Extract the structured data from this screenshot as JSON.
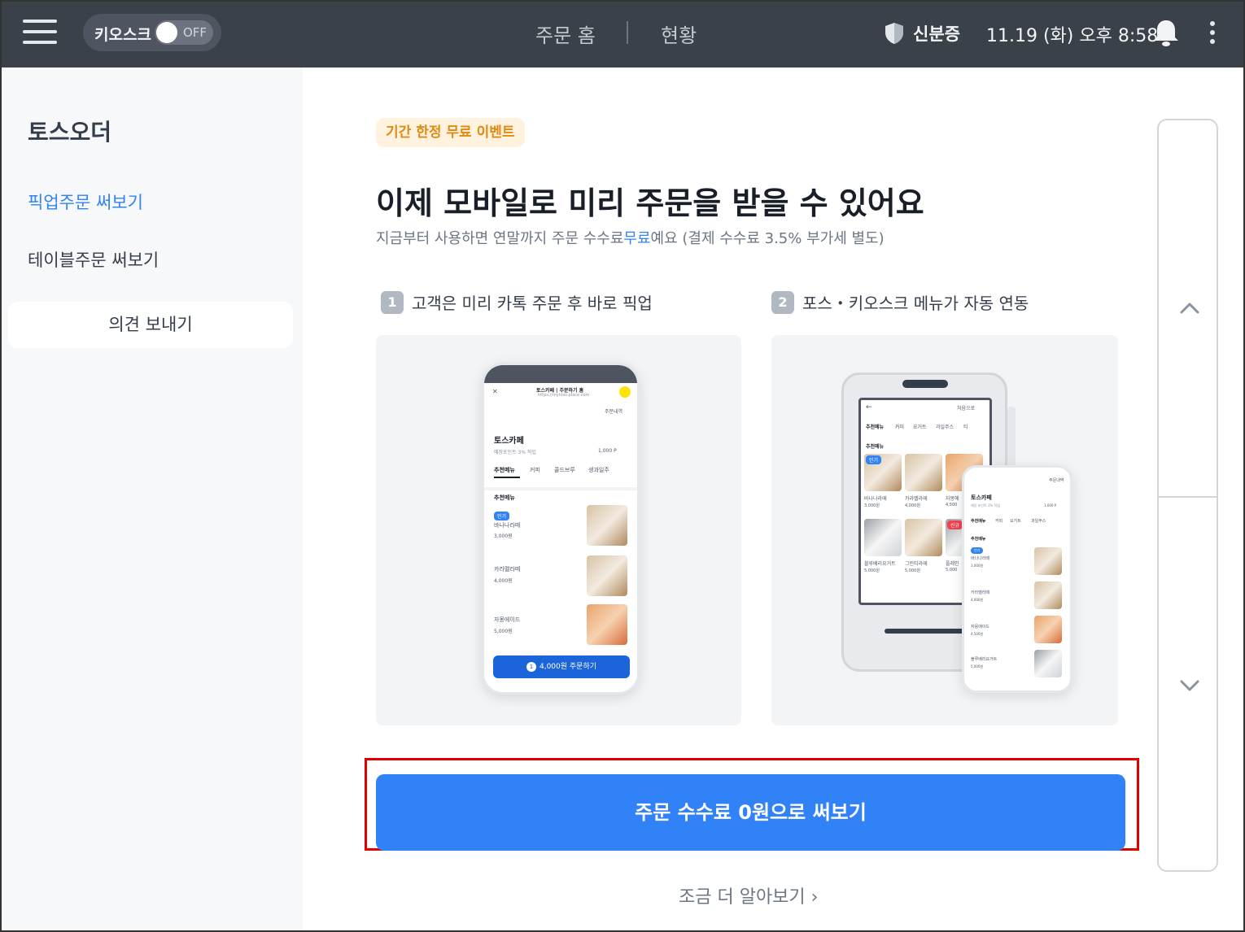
{
  "topbar": {
    "kiosk_label": "키오스크",
    "kiosk_toggle": "OFF",
    "nav_home": "주문 홈",
    "nav_status": "현황",
    "id_label": "신분증",
    "datetime": "11.19 (화) 오후 8:58"
  },
  "sidebar": {
    "title": "토스오더",
    "items": [
      {
        "label": "픽업주문 써보기"
      },
      {
        "label": "테이블주문 써보기"
      }
    ],
    "feedback": "의견 보내기"
  },
  "main": {
    "badge": "기간 한정 무료 이벤트",
    "headline": "이제 모바일로 미리 주문을 받을 수 있어요",
    "sub_pre": "지금부터 사용하면 연말까지 주문 수수료",
    "sub_hl": "무료",
    "sub_post": "예요 (결제 수수료 3.5% 부가세 별도)",
    "steps": [
      {
        "num": "1",
        "label": "고객은 미리 카톡 주문 후 바로 픽업"
      },
      {
        "num": "2",
        "label": "포스・키오스크 메뉴가 자동 연동"
      }
    ],
    "cta": "주문 수수료 0원으로 써보기",
    "more": "조금 더 알아보기 ›"
  },
  "phone1": {
    "url_title": "토스카페 | 주문하기 홈",
    "url": "https://mytoss.place.com",
    "history": "주문내역",
    "store": "토스카페",
    "points": "매장포인트 3% 적립",
    "points_val": "1,000 P",
    "tabs": [
      "추천메뉴",
      "커피",
      "콜드브루",
      "생과일주"
    ],
    "section": "추천메뉴",
    "tag": "인기",
    "menu": [
      {
        "name": "바나나라떼",
        "price": "3,000원"
      },
      {
        "name": "카라멜라떼",
        "price": "4,000원"
      },
      {
        "name": "자몽에이드",
        "price": "5,000원"
      }
    ],
    "order_count": "1",
    "order_btn": "4,000원 주문하기"
  },
  "kiosk": {
    "reset": "처음으로",
    "tabs": [
      "추천메뉴",
      "커피",
      "요거트",
      "과일주스",
      "티"
    ],
    "section": "추천메뉴",
    "tag": "인기",
    "tag2": "신규",
    "items": [
      {
        "name": "바나나라떼",
        "price": "3,000원"
      },
      {
        "name": "카라멜라떼",
        "price": "4,000원"
      },
      {
        "name": "자몽에",
        "price": "4,500"
      },
      {
        "name": "블루베리요거트",
        "price": "5,000원"
      },
      {
        "name": "그린티라떼",
        "price": "5,000원"
      },
      {
        "name": "플레인",
        "price": "5,000"
      }
    ]
  },
  "phone2": {
    "history": "주문내역",
    "store": "토스카페",
    "points": "매장 포인트 3% 적립",
    "points_val": "1,000 P",
    "tabs": [
      "추천메뉴",
      "커피",
      "요거트",
      "과일주스"
    ],
    "section": "추천메뉴",
    "tag": "인기",
    "menu": [
      {
        "name": "바나나라떼",
        "price": "3,000원"
      },
      {
        "name": "카라멜라떼",
        "price": "4,000원"
      },
      {
        "name": "자몽에이드",
        "price": "4,500원"
      },
      {
        "name": "블루베리요거트",
        "price": "5,000원"
      }
    ]
  },
  "colors": {
    "topbar": "#3b4149",
    "accent": "#3182f6",
    "badge_bg": "#fff2de",
    "badge_text": "#e08a12",
    "highlight_border": "#e00000"
  },
  "icons": [
    "menu-icon",
    "shield-icon",
    "bell-icon",
    "more-vertical-icon",
    "chevron-up-icon",
    "chevron-down-icon"
  ]
}
